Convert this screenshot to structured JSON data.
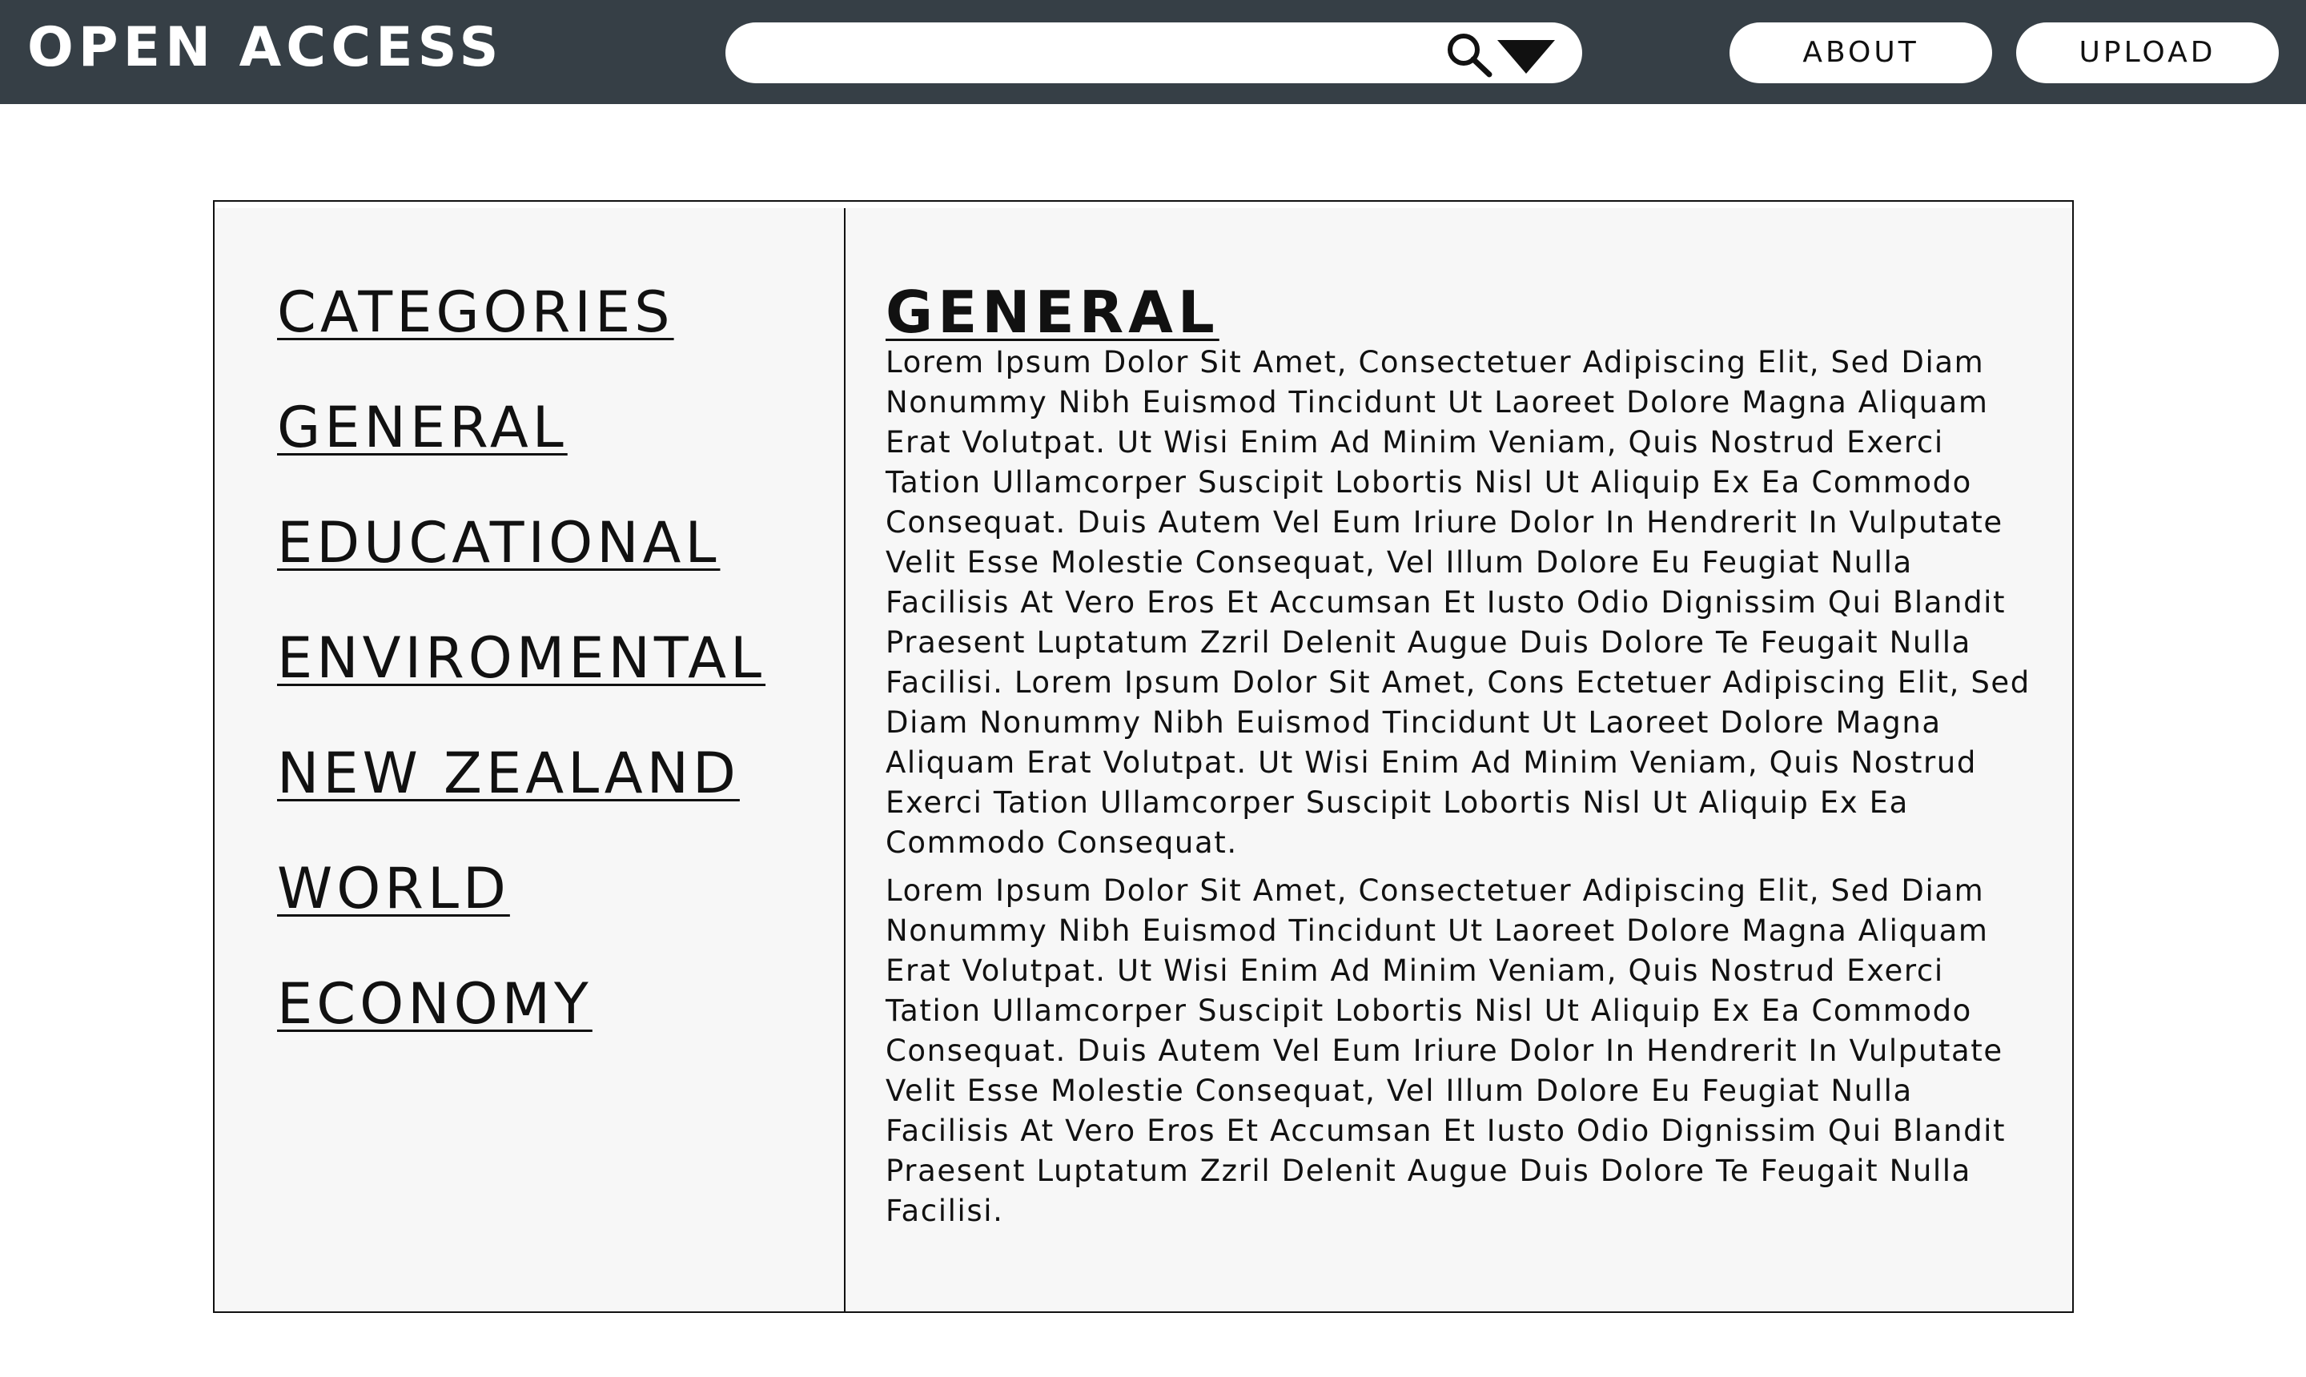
{
  "header": {
    "brand": "OPEN ACCESS",
    "search": {
      "value": "",
      "placeholder": ""
    },
    "about_label": "ABOUT",
    "upload_label": "UPLOAD"
  },
  "sidebar": {
    "items": [
      {
        "label": "CATEGORIES"
      },
      {
        "label": "GENERAL"
      },
      {
        "label": "EDUCATIONAL"
      },
      {
        "label": "ENVIROMENTAL"
      },
      {
        "label": "NEW ZEALAND"
      },
      {
        "label": "WORLD"
      },
      {
        "label": "ECONOMY"
      }
    ]
  },
  "content": {
    "title": "GENERAL",
    "paragraphs": [
      "Lorem Ipsum Dolor Sit Amet, Consectetuer Adipiscing Elit, Sed Diam Nonummy Nibh Euismod Tincidunt Ut Laoreet Dolore Magna Aliquam Erat Volutpat. Ut Wisi Enim Ad Minim Veniam, Quis Nostrud Exerci Tation Ullamcorper Suscipit Lobortis Nisl Ut Aliquip Ex Ea Commodo Consequat. Duis Autem Vel Eum Iriure Dolor In Hendrerit In Vulputate Velit Esse Molestie Consequat, Vel Illum Dolore Eu Feugiat Nulla Facilisis At Vero Eros Et Accumsan Et Iusto Odio Dignissim Qui Blandit Praesent Luptatum Zzril Delenit Augue Duis Dolore Te Feugait Nulla Facilisi.  Lorem Ipsum Dolor Sit Amet, Cons Ectetuer Adipiscing Elit, Sed Diam Nonummy Nibh Euismod Tincidunt Ut Laoreet Dolore Magna Aliquam Erat Volutpat. Ut Wisi Enim Ad Minim Veniam, Quis Nostrud Exerci Tation Ullamcorper Suscipit Lobortis Nisl Ut Aliquip Ex Ea Commodo Consequat.",
      "Lorem Ipsum Dolor Sit Amet, Consectetuer Adipiscing Elit, Sed Diam Nonummy Nibh Euismod Tincidunt Ut Laoreet Dolore Magna Aliquam Erat Volutpat. Ut Wisi Enim Ad Minim Veniam, Quis Nostrud Exerci Tation Ullamcorper Suscipit Lobortis Nisl Ut Aliquip Ex Ea Commodo Consequat. Duis Autem Vel Eum Iriure Dolor In Hendrerit In Vulputate Velit Esse Molestie Consequat, Vel Illum Dolore Eu Feugiat Nulla Facilisis At Vero Eros Et Accumsan Et Iusto Odio Dignissim Qui Blandit Praesent Luptatum Zzril Delenit Augue Duis Dolore Te Feugait Nulla Facilisi."
    ]
  },
  "colors": {
    "header_bg": "#363f46",
    "panel_bg": "#f7f7f7",
    "text": "#111111"
  },
  "icons": {
    "search": "search-icon",
    "dropdown": "triangle-down-icon"
  }
}
